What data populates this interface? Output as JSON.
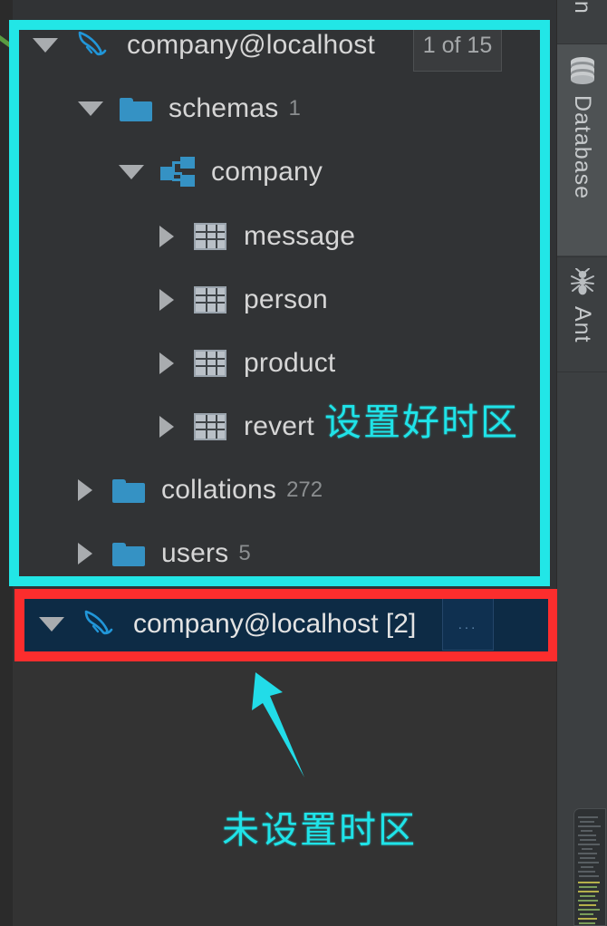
{
  "app": {
    "theme_bg": "#333333",
    "panel_bg": "#313335",
    "accent_blue": "#3592c4",
    "selection_bg": "#0d2b45",
    "highlight_cyan": "#22e6e6",
    "highlight_red": "#fc2d2d"
  },
  "database_tree": {
    "connection": {
      "label": "company@localhost",
      "badge": "1 of 15",
      "expanded": true,
      "icon": "mysql-dolphin-icon"
    },
    "nodes": [
      {
        "label": "schemas",
        "count": "1",
        "icon": "folder-icon",
        "expanded": true,
        "depth": 1
      },
      {
        "label": "company",
        "count": "",
        "icon": "schema-icon",
        "expanded": true,
        "depth": 2
      },
      {
        "label": "message",
        "count": "",
        "icon": "table-icon",
        "expanded": false,
        "depth": 3
      },
      {
        "label": "person",
        "count": "",
        "icon": "table-icon",
        "expanded": false,
        "depth": 3
      },
      {
        "label": "product",
        "count": "",
        "icon": "table-icon",
        "expanded": false,
        "depth": 3
      },
      {
        "label": "revert",
        "count": "",
        "icon": "table-icon",
        "expanded": false,
        "depth": 3
      },
      {
        "label": "collations",
        "count": "272",
        "icon": "folder-icon",
        "expanded": false,
        "depth": 1
      },
      {
        "label": "users",
        "count": "5",
        "icon": "folder-icon",
        "expanded": false,
        "depth": 1
      }
    ],
    "selected_connection": {
      "label": "company@localhost [2]",
      "expanded": true,
      "icon": "mysql-dolphin-icon",
      "more_button": "..."
    }
  },
  "annotations": [
    {
      "text": "设置好时区",
      "note": "timezone configured"
    },
    {
      "text": "未设置时区",
      "note": "timezone not configured"
    }
  ],
  "tool_window_bar": {
    "tabs": [
      {
        "label": "en",
        "icon": "maven-icon",
        "active": false,
        "clipped": true
      },
      {
        "label": "Database",
        "icon": "database-icon",
        "active": true,
        "clipped": false
      },
      {
        "label": "Ant",
        "icon": "ant-icon",
        "active": false,
        "clipped": false
      }
    ]
  }
}
